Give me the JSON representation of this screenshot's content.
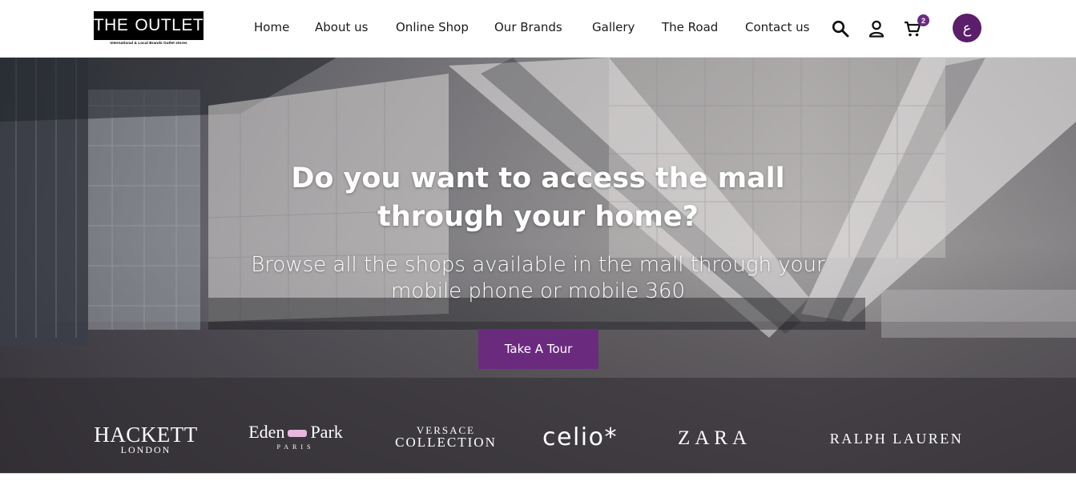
{
  "header": {
    "logo": {
      "name": "THE OUTLET",
      "word1": "THE",
      "word2": "OUTLET",
      "tagline": "International & Local Brands Outlet stores"
    },
    "nav": [
      {
        "label": "Home"
      },
      {
        "label": "About us"
      },
      {
        "label": "Online Shop"
      },
      {
        "label": "Our Brands"
      },
      {
        "label": "Gallery"
      },
      {
        "label": "The Road"
      },
      {
        "label": "Contact us"
      }
    ],
    "icons": {
      "search": "search-icon",
      "user": "user-icon",
      "cart": "cart-icon"
    },
    "cart_count": "2",
    "language_toggle": "ع"
  },
  "hero": {
    "title": "Do you want to access the mall through your home?",
    "subtitle": "Browse all the shops available in the mall through your mobile phone or mobile 360",
    "cta_label": "Take A Tour"
  },
  "brands": [
    {
      "line1": "HACKETT",
      "line2": "LONDON"
    },
    {
      "line1a": "Eden",
      "line1b": "Park",
      "line2": "PARIS"
    },
    {
      "line1": "VERSACE",
      "line2": "COLLECTION"
    },
    {
      "line1": "celio*"
    },
    {
      "line1": "ZARA"
    },
    {
      "line1": "RALPH LAUREN"
    }
  ],
  "colors": {
    "accent": "#6a2b7f",
    "lang_bg": "#5a1e6b",
    "text": "#1a1a1a"
  }
}
